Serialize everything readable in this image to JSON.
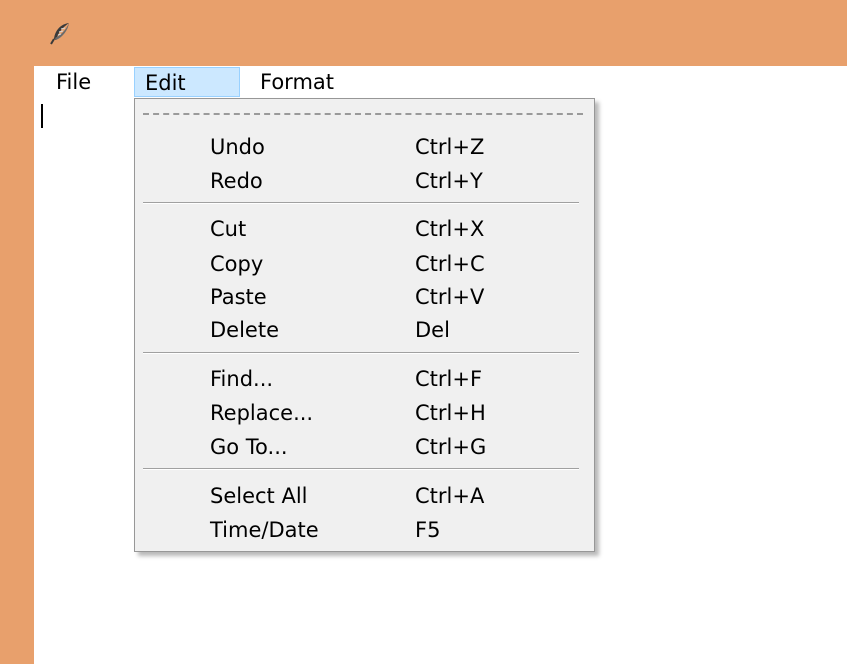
{
  "window": {
    "icon": "feather-icon"
  },
  "menubar": {
    "items": [
      {
        "label": "File"
      },
      {
        "label": "Edit"
      },
      {
        "label": "Format"
      }
    ]
  },
  "edit_menu": {
    "items": [
      {
        "label": "Undo",
        "shortcut": "Ctrl+Z"
      },
      {
        "label": "Redo",
        "shortcut": "Ctrl+Y"
      },
      {
        "label": "Cut",
        "shortcut": "Ctrl+X"
      },
      {
        "label": "Copy",
        "shortcut": "Ctrl+C"
      },
      {
        "label": "Paste",
        "shortcut": "Ctrl+V"
      },
      {
        "label": "Delete",
        "shortcut": "Del"
      },
      {
        "label": "Find...",
        "shortcut": "Ctrl+F"
      },
      {
        "label": "Replace...",
        "shortcut": "Ctrl+H"
      },
      {
        "label": "Go To...",
        "shortcut": "Ctrl+G"
      },
      {
        "label": "Select All",
        "shortcut": "Ctrl+A"
      },
      {
        "label": "Time/Date",
        "shortcut": "F5"
      }
    ]
  },
  "colors": {
    "titlebar": "#e8a06c",
    "menu_highlight": "#cce8ff",
    "menu_background": "#f0f0f0"
  }
}
